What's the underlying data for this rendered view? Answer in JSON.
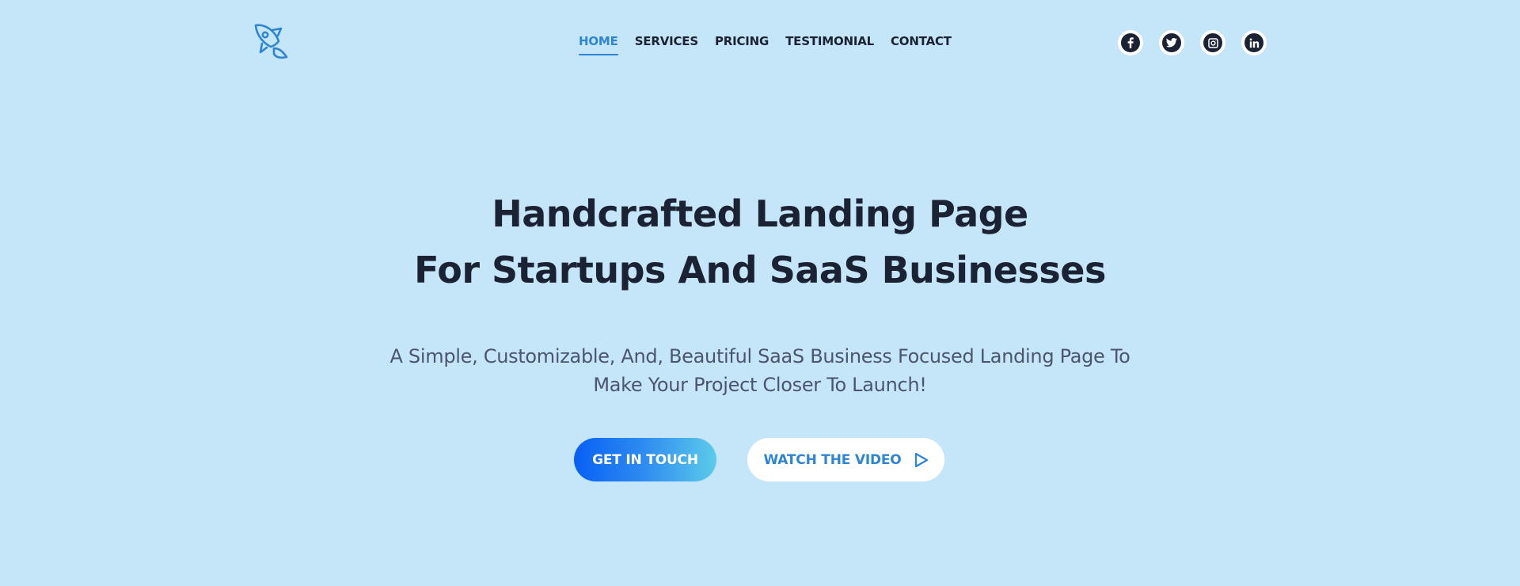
{
  "colors": {
    "background": "#c5e5f8",
    "accent": "#2e85d3",
    "text": "#1b2233",
    "muted": "#4b5570",
    "button_gradient_start": "#0860f4",
    "button_gradient_end": "#5ccbea"
  },
  "header": {
    "logo_icon": "rocket-icon",
    "nav": [
      {
        "label": "HOME",
        "active": true
      },
      {
        "label": "SERVICES",
        "active": false
      },
      {
        "label": "PRICING",
        "active": false
      },
      {
        "label": "TESTIMONIAL",
        "active": false
      },
      {
        "label": "CONTACT",
        "active": false
      }
    ],
    "socials": [
      {
        "icon": "facebook-icon"
      },
      {
        "icon": "twitter-icon"
      },
      {
        "icon": "instagram-icon"
      },
      {
        "icon": "linkedin-icon"
      }
    ]
  },
  "hero": {
    "title_line1": "Handcrafted Landing Page",
    "title_line2": "For Startups And SaaS Businesses",
    "subtitle_line1": "A Simple, Customizable, And, Beautiful SaaS Business Focused Landing Page To",
    "subtitle_line2": "Make Your Project Closer To Launch!",
    "primary_button": "GET IN TOUCH",
    "secondary_button": "WATCH THE VIDEO",
    "secondary_button_icon": "play-icon"
  }
}
